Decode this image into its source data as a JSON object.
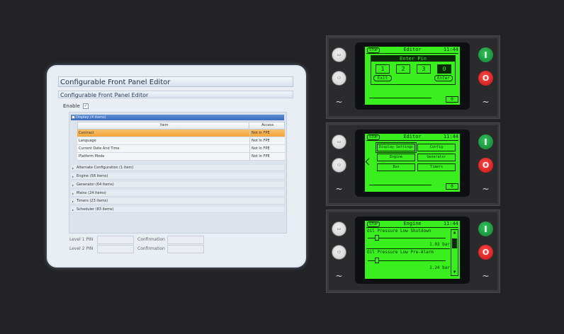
{
  "editor": {
    "title": "Configurable Front Panel Editor",
    "subtitle": "Configurable Front Panel Editor",
    "enable_label": "Enable",
    "enable_checked": true,
    "display_group": "Display (4 items)",
    "columns": {
      "item": "Item",
      "access": "Access"
    },
    "rows": [
      {
        "item": "Contract",
        "access": "Not In FPE"
      },
      {
        "item": "Language",
        "access": "Not In FPE"
      },
      {
        "item": "Current Date And Time",
        "access": "Not In FPE"
      },
      {
        "item": "Platform Mode",
        "access": "Not In FPE"
      }
    ],
    "groups": [
      "Alternate Configuration (1 item)",
      "Engine (58 items)",
      "Generator (64 items)",
      "Mains (24 items)",
      "Timers (23 items)",
      "Scheduler (83 items)"
    ],
    "pin": {
      "level1": "Level 1 PIN",
      "level2": "Level 2 PIN",
      "confirmation": "Confirmation"
    }
  },
  "modules": {
    "stop_label": "STOP",
    "time": "11:44",
    "pin_screen": {
      "title": "Editor",
      "header": "Enter Pin",
      "digits": [
        "1",
        "2",
        "3",
        "0"
      ],
      "exit": "Exit",
      "enter": "Enter",
      "page": "0"
    },
    "menu_screen": {
      "title": "Editor",
      "buttons": [
        "Display Settings",
        "Config",
        "Engine",
        "Generator",
        "Bus",
        "Timers"
      ],
      "page": "0"
    },
    "engine_screen": {
      "title": "Engine",
      "items": [
        {
          "label": "Oil Pressure Low Shutdown",
          "value": "1.03 bar"
        },
        {
          "label": "Oil Pressure Low Pre-Alarm",
          "value": "1.24 bar"
        }
      ]
    },
    "button_glyphs": {
      "start": "I",
      "stop": "O",
      "dash": "~"
    }
  }
}
